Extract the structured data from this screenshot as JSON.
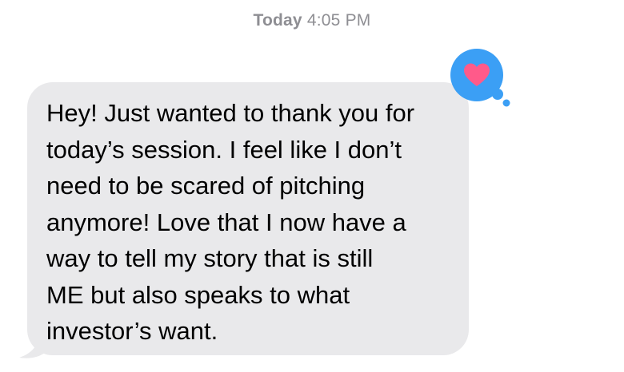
{
  "header": {
    "timestamp_day": "Today",
    "timestamp_time": "4:05 PM"
  },
  "message": {
    "text": "Hey! Just wanted to thank you for\ntoday’s session. I feel like I don’t\nneed to be scared of pitching\nanymore! Love that I now have a\nway to tell my story that is still\nME but also speaks to what\ninvestor’s want.",
    "bubble_color": "#e9e9eb",
    "text_color": "#000000"
  },
  "reaction": {
    "icon": "heart-icon",
    "bubble_color": "#3b9ff5",
    "heart_color": "#ff5a8a"
  }
}
